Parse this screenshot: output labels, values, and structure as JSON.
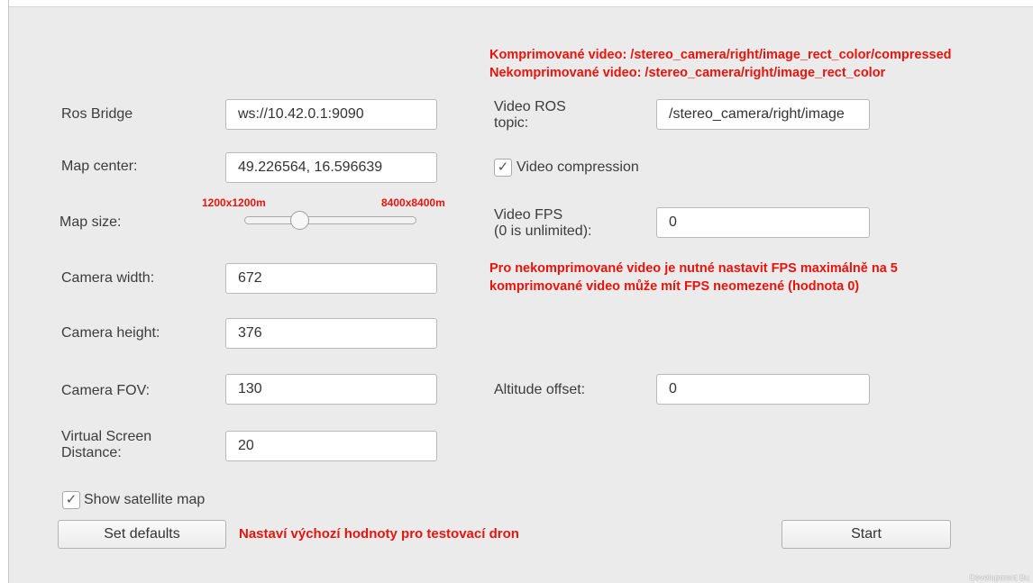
{
  "labels": {
    "ros_bridge": "Ros Bridge",
    "map_center": "Map center:",
    "map_size": "Map size:",
    "camera_width": "Camera width:",
    "camera_height": "Camera height:",
    "camera_fov": "Camera FOV:",
    "virtual_screen_line1": "Virtual Screen",
    "virtual_screen_line2": "Distance:",
    "video_ros_line1": "Video ROS",
    "video_ros_line2": "topic:",
    "video_fps_line1": "Video FPS",
    "video_fps_line2": "(0 is unlimited):",
    "altitude_offset": "Altitude offset:"
  },
  "fields": {
    "ros_bridge": "ws://10.42.0.1:9090",
    "map_center": "49.226564, 16.596639",
    "camera_width": "672",
    "camera_height": "376",
    "camera_fov": "130",
    "virtual_screen_distance": "20",
    "video_ros_topic": "/stereo_camera/right/image",
    "video_fps": "0",
    "altitude_offset": "0"
  },
  "slider": {
    "min_label": "1200x1200m",
    "max_label": "8400x8400m",
    "level_fraction": 0.3
  },
  "checkboxes": {
    "video_compression": {
      "label": "Video compression",
      "checked": true,
      "mark": "✓"
    },
    "show_satellite_map": {
      "label": "Show satellite map",
      "checked": true,
      "mark": "✓"
    }
  },
  "buttons": {
    "set_defaults": "Set defaults",
    "start": "Start"
  },
  "annotations": {
    "compressed_line": "Komprimované video: /stereo_camera/right/image_rect_color/compressed",
    "uncompressed_line": "Nekomprimované video: /stereo_camera/right/image_rect_color",
    "fps_note_line1": "Pro nekomprimované video je nutné nastavit FPS maximálně na 5",
    "fps_note_line2": "komprimované video může mít FPS neomezené (hodnota 0)",
    "defaults_note": "Nastaví výchozí hodnoty pro  testovací dron"
  },
  "watermark": "Development Bu",
  "colors": {
    "annotation": "#e8140c",
    "background": "#ebebeb"
  }
}
